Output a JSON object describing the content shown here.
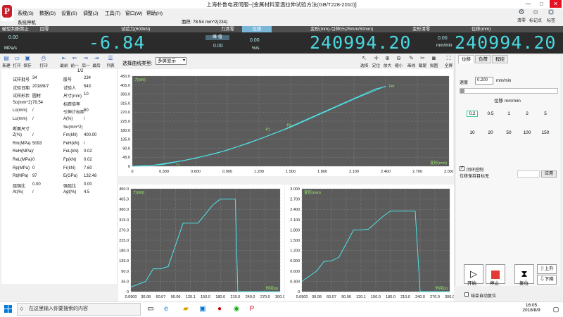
{
  "window": {
    "title": "上海朴鲁电液伺服--[金属材料室温拉伸试验方法(GB/T228-2010)]",
    "subtitle": "系统停机",
    "area_text": "面积: 78.54 mm^2(234)",
    "controls": {
      "minimize": "—",
      "restore": "□",
      "close": "✕"
    }
  },
  "menu": [
    "系统(S)",
    "数据(D)",
    "设置(S)",
    "调整(J)",
    "工具(T)",
    "窗口(W)",
    "帮助(H)"
  ],
  "top_icons": [
    {
      "label": "清零",
      "icon": "gear-icon"
    },
    {
      "label": "标记点",
      "icon": "user-icon"
    },
    {
      "label": "标签",
      "icon": "tag-icon"
    }
  ],
  "header": {
    "left1": "破型判断禁止",
    "left2": "回零",
    "force": "试验力(600kN)",
    "force_zero": "力清零",
    "displacement_label": "位移",
    "deformation": "变形(mm)-引伸计(25mm/50mm)",
    "deformation_zero": "变形清零",
    "position": "位移(mm)"
  },
  "readings": {
    "stress": "0.00",
    "stress_unit": "MPa/s",
    "force": "-6.84",
    "mode_label": "峰 值",
    "peak": "0.00",
    "strain_rate": "0.00",
    "strain_unit": "%/s",
    "deformation": "240994.20",
    "disp_rate": "0.00",
    "disp_rate_unit": "mm/min",
    "position": "240994.20"
  },
  "toolbar": [
    {
      "label": "新建",
      "icon": "new-file-icon"
    },
    {
      "label": "打开",
      "icon": "folder-icon"
    },
    {
      "label": "保存",
      "icon": "save-icon"
    },
    {
      "label": "打印",
      "icon": "print-icon"
    },
    {
      "label": "最前",
      "icon": "first-icon"
    },
    {
      "label": "前一",
      "icon": "prev-icon"
    },
    {
      "label": "后一",
      "icon": "next-icon"
    },
    {
      "label": "最后",
      "icon": "last-icon"
    },
    {
      "label": "列表",
      "icon": "list-icon"
    }
  ],
  "record_counter": "1/2",
  "params": [
    [
      "试样批号",
      "34",
      "股号",
      "234"
    ],
    [
      "试验日期",
      "2018/8/7",
      "试验人",
      "543"
    ],
    [
      "试样形状",
      "圆材",
      "尺寸(mm)",
      "10"
    ],
    [
      "So(mm^2)",
      "78.54",
      "标距倍率",
      ""
    ],
    [
      "Lo(mm)",
      "/",
      "引伸计标距",
      "50"
    ],
    [
      "Lu(mm)",
      "/",
      "A(%)",
      "/"
    ],
    [
      "断面尺寸",
      "",
      "Su(mm^2)",
      ""
    ],
    [
      "Z(%)",
      "/",
      "Fm(kN)",
      "400.00"
    ],
    [
      "Rm(MPa)",
      "5093",
      "FeH(kN)",
      "/"
    ],
    [
      "ReH(MPa)",
      "/",
      "FeL(kN)",
      "0.02"
    ],
    [
      "ReL(MPa)",
      "0",
      "Fp(kN)",
      "0.02"
    ],
    [
      "Rp(MPa)",
      "0",
      "Fr(kN)",
      "7.60"
    ],
    [
      "Rt(MPa)",
      "97",
      "E(GPa)",
      "132.48"
    ],
    [
      "屈强比",
      "0.00",
      "强屈比",
      "0.00"
    ],
    [
      "At(%)",
      "/",
      "Agt(%)",
      "4.5"
    ]
  ],
  "curve_select": {
    "label": "选择曲线类型:",
    "value": "多屏显示"
  },
  "chart_tools": [
    {
      "label": "选择",
      "icon": "pointer-icon"
    },
    {
      "label": "定位",
      "icon": "crosshair-icon"
    },
    {
      "label": "放大",
      "icon": "zoom-in-icon"
    },
    {
      "label": "缩小",
      "icon": "zoom-out-icon"
    },
    {
      "label": "画线",
      "icon": "pen-icon"
    },
    {
      "label": "截尾",
      "icon": "scissors-icon"
    },
    {
      "label": "拟图",
      "icon": "camera-icon"
    },
    {
      "label": "全屏",
      "icon": "fullscreen-icon"
    }
  ],
  "right_panel": {
    "tabs": [
      "位移",
      "负荷",
      "程控"
    ],
    "speed_label": "速度",
    "speed_value": "0.200",
    "speed_unit": "mm/min",
    "section_title": "位移 mm/min",
    "speeds": [
      "0.2",
      "0.5",
      "1",
      "2",
      "5",
      "10",
      "20",
      "50",
      "100",
      "150"
    ],
    "closed_loop": "闭环控制",
    "target_label": "位移保持目标无",
    "apply": "应用",
    "start": "开始",
    "stop": "停止",
    "reset": "复位",
    "up": "上升",
    "down": "下降",
    "end_return": "结束自动复位"
  },
  "taskbar": {
    "search": "在这里输入你要搜索的内容",
    "time": "16:05",
    "date": "2018/8/9"
  },
  "chart_data": [
    {
      "type": "line",
      "title": "",
      "ylabel": "力(kN)",
      "xlabel": "变形(mm)",
      "xlim": [
        0,
        3.0
      ],
      "ylim": [
        0,
        450.0
      ],
      "xticks": [
        "0",
        "0.300",
        "0.600",
        "0.900",
        "1.200",
        "1.500",
        "1.800",
        "2.100",
        "2.400",
        "2.700",
        "3.000"
      ],
      "yticks": [
        "0",
        "45.0",
        "90.0",
        "135.0",
        "180.0",
        "225.0",
        "270.0",
        "315.0",
        "360.0",
        "405.0",
        "450.0"
      ],
      "series": [
        {
          "x": [
            0,
            0.15,
            0.3,
            0.6,
            0.9,
            1.2,
            1.5,
            1.8,
            2.1,
            2.4
          ],
          "y": [
            0,
            3,
            10,
            40,
            80,
            135,
            195,
            265,
            335,
            400
          ]
        },
        {
          "x": [
            0,
            0.2,
            0.5,
            0.8,
            1.1,
            1.4,
            1.7,
            2.0,
            2.3,
            2.4
          ],
          "y": [
            0,
            5,
            30,
            65,
            115,
            175,
            245,
            315,
            385,
            398
          ]
        }
      ],
      "markers": [
        {
          "label": "T1",
          "x": 0.4,
          "y": 5
        },
        {
          "label": "P1",
          "x": 1.25,
          "y": 185
        },
        {
          "label": "P2",
          "x": 1.45,
          "y": 205
        },
        {
          "label": "Fm",
          "x": 2.42,
          "y": 400
        }
      ]
    },
    {
      "type": "line",
      "title": "",
      "ylabel": "力(kN)",
      "xlabel": "时间(s)",
      "xlim": [
        0.09,
        300
      ],
      "ylim": [
        0,
        450.0
      ],
      "xticks": [
        "0.0900",
        "30.08",
        "60.07",
        "90.06",
        "120.1",
        "150.0",
        "180.0",
        "210.0",
        "240.0",
        "270.0",
        "300.0"
      ],
      "yticks": [
        "0",
        "45.0",
        "90.0",
        "135.0",
        "180.0",
        "225.0",
        "270.0",
        "315.0",
        "360.0",
        "405.0",
        "450.0"
      ],
      "series": [
        {
          "x": [
            0.09,
            30,
            45,
            60,
            75,
            105,
            120,
            135,
            165,
            180,
            210,
            215,
            300
          ],
          "y": [
            20,
            45,
            100,
            100,
            110,
            300,
            300,
            300,
            380,
            405,
            405,
            0,
            0
          ]
        }
      ]
    },
    {
      "type": "line",
      "title": "",
      "ylabel": "变形(mm)",
      "xlabel": "时间(s)",
      "xlim": [
        0.09,
        300
      ],
      "ylim": [
        0,
        3.0
      ],
      "xticks": [
        "0.0900",
        "30.08",
        "60.07",
        "90.06",
        "120.1",
        "150.0",
        "180.0",
        "210.0",
        "240.0",
        "270.0",
        "300.0"
      ],
      "yticks": [
        "0",
        "0.300",
        "0.600",
        "0.900",
        "1.200",
        "1.500",
        "1.800",
        "2.100",
        "2.400",
        "2.700",
        "3.000"
      ],
      "series": [
        {
          "x": [
            0.09,
            30,
            45,
            60,
            75,
            105,
            120,
            135,
            165,
            180,
            210,
            230,
            240,
            300
          ],
          "y": [
            0.3,
            0.6,
            0.88,
            0.9,
            1.0,
            1.8,
            1.8,
            1.82,
            2.2,
            2.35,
            2.35,
            2.35,
            0,
            0
          ]
        }
      ]
    }
  ]
}
